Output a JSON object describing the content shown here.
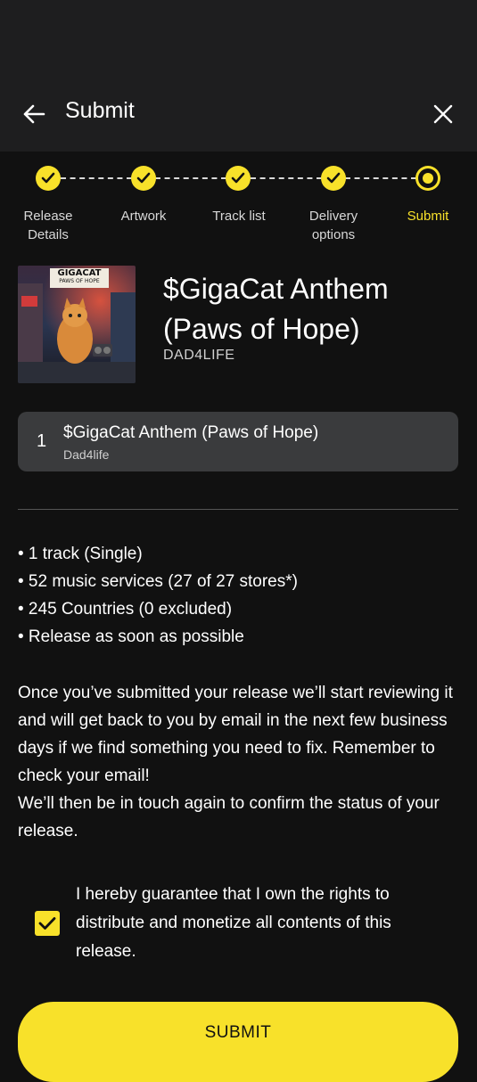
{
  "header": {
    "title": "Submit",
    "back_icon": "arrow-left-icon",
    "close_icon": "close-icon"
  },
  "stepper": {
    "steps": [
      {
        "label": "Release Details",
        "state": "done"
      },
      {
        "label": "Artwork",
        "state": "done"
      },
      {
        "label": "Track list",
        "state": "done"
      },
      {
        "label": "Delivery options",
        "state": "done"
      },
      {
        "label": "Submit",
        "state": "current"
      }
    ]
  },
  "release": {
    "title": "$GigaCat Anthem (Paws of Hope)",
    "artist": "DAD4LIFE",
    "cover_text": "GIGACAT",
    "cover_subtext": "PAWS OF HOPE"
  },
  "tracks": [
    {
      "number": "1",
      "title": "$GigaCat Anthem (Paws of Hope)",
      "artist": "Dad4life"
    }
  ],
  "summary": [
    "• 1 track (Single)",
    "• 52 music services (27 of 27 stores*)",
    "• 245 Countries (0 excluded)",
    "• Release as soon as possible"
  ],
  "info_text": [
    "Once you’ve submitted your release we’ll start reviewing it and will get back to you by email in the next few business days if we find something you need to fix. Remember to check your email!",
    "We’ll then be in touch again to confirm the status of your release."
  ],
  "guarantee": {
    "checked": true,
    "text": "I hereby guarantee that I own the rights to distribute and monetize all contents of this release."
  },
  "submit_button": "SUBMIT",
  "colors": {
    "accent": "#f8e12a",
    "background": "#111111",
    "appbar": "#1e1e1f",
    "card": "#3a3b3d"
  }
}
